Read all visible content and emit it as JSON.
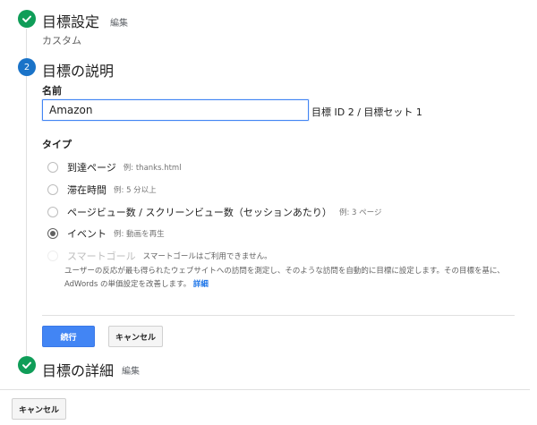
{
  "step1": {
    "title": "目標設定",
    "edit": "編集",
    "summary": "カスタム"
  },
  "step2": {
    "number": "2",
    "title": "目標の説明"
  },
  "name_section": {
    "label": "名前",
    "input_value": "Amazon",
    "goal_id": "目標 ID 2 / 目標セット 1"
  },
  "type_section": {
    "label": "タイプ",
    "options": [
      {
        "label": "到達ページ",
        "example": "例: thanks.html",
        "checked": false,
        "disabled": false
      },
      {
        "label": "滞在時間",
        "example": "例: 5 分以上",
        "checked": false,
        "disabled": false
      },
      {
        "label": "ページビュー数 / スクリーンビュー数（セッションあたり）",
        "example": "例: 3 ページ",
        "checked": false,
        "disabled": false
      },
      {
        "label": "イベント",
        "example": "例: 動画を再生",
        "checked": true,
        "disabled": false
      },
      {
        "label": "スマートゴール",
        "example": "スマートゴールはご利用できません。",
        "checked": false,
        "disabled": true
      }
    ],
    "smart_description": "ユーザーの反応が最も得られたウェブサイトへの訪問を測定し、そのような訪問を自動的に目標に設定します。その目標を基に、AdWords の単価設定を改善します。",
    "detail_link": "詳細"
  },
  "actions": {
    "continue_label": "続行",
    "cancel_label": "キャンセル"
  },
  "step3": {
    "title": "目標の詳細",
    "edit": "編集"
  },
  "footer": {
    "cancel_label": "キャンセル"
  },
  "colors": {
    "check": "#0f9d58",
    "step_number": "#1a73c8",
    "primary": "#4285f4",
    "link": "#1a73e8"
  }
}
